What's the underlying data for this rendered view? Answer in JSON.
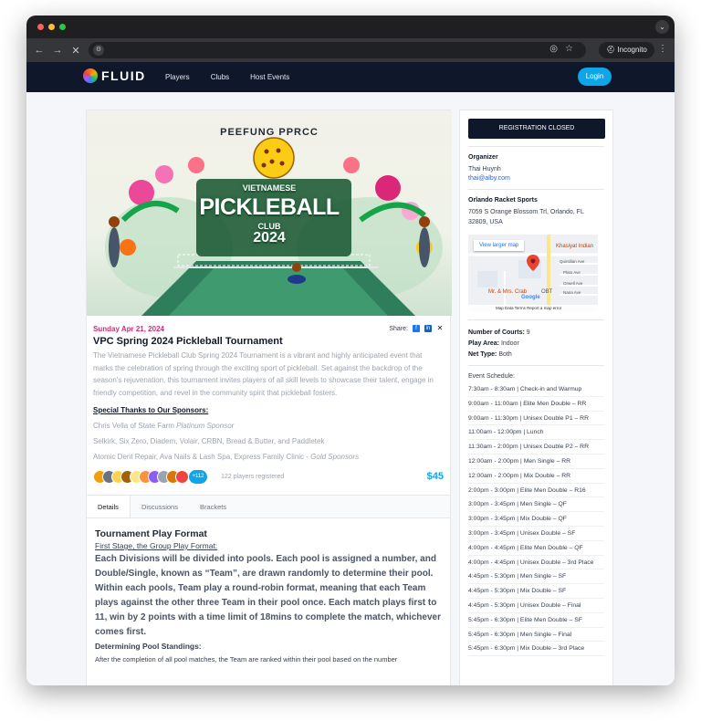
{
  "browser": {
    "back_icon": "←",
    "forward_icon": "→",
    "close_icon": "✕",
    "incognito_label": "Incognito"
  },
  "site": {
    "logo_text": "FLUID",
    "nav": [
      "Players",
      "Clubs",
      "Host Events"
    ],
    "login_label": "Login"
  },
  "banner": {
    "arc_text": "PEEFUNG PPRCC",
    "line1": "VIETNAMESE",
    "line2": "PICKLEBALL",
    "line3": "CLUB",
    "line4": "2024"
  },
  "event": {
    "date": "Sunday Apr 21, 2024",
    "share_label": "Share:",
    "title": "VPC Spring 2024 Pickleball Tournament",
    "description": "The Vietnamese Pickleball Club Spring 2024 Tournament is a vibrant and highly anticipated event that marks the celebration of spring through the exciting sport of pickleball. Set against the backdrop of the season's rejuvenation, this tournament invites players of all skill levels to showcase their talent, engage in friendly competition, and revel in the community spirit that pickleball fosters.",
    "sponsors_heading": "Special Thanks to Our Sponsors:",
    "sponsor1_text": "Chris Vella of State Farm ",
    "sponsor1_tier": "Platinum Sponsor",
    "sponsor2_text": "Selkirk, Six Zero, Diadem, Volair, CRBN, Bread & Butter, and Paddletek",
    "sponsor3_text": "Atomic Dent Repair, Ava Nails & Lash Spa, Express Family Clinic - ",
    "sponsor3_tier": "Gold Sponsors",
    "more_count": "+112",
    "registered": "122 players registered",
    "price": "$45"
  },
  "tabs": [
    "Details",
    "Discussions",
    "Brackets"
  ],
  "details": {
    "heading": "Tournament Play Format",
    "stage_heading": "First Stage, the Group Play Format:",
    "paragraph": "Each Divisions will be divided into pools. Each pool is assigned a number, and Double/Single, known as “Team”, are drawn randomly to determine their pool. Within each pools, Team play a round-robin format, meaning that each Team plays against the other three Team in their pool once. Each match plays first to 11, win by 2 points with a time limit of 18mins to complete the match, whichever comes first.",
    "standings_heading": "Determining Pool Standings:",
    "standings_text": "After the completion of all pool matches, the Team are ranked within their pool based on the number"
  },
  "sidebar": {
    "registration_label": "REGISTRATION CLOSED",
    "organizer_label": "Organizer",
    "organizer_name": "Thai Huynh",
    "organizer_email": "thai@alby.com",
    "venue_name": "Orlando Racket Sports",
    "venue_address": "7059 S Orange Blossom Trl, Orlando, FL 32809, USA",
    "map": {
      "view_larger": "View larger map",
      "place1": "Khasiyat Indian",
      "street1": "Quintilian Ave",
      "street2": "Plato Ave",
      "street3": "Orwell Ave",
      "street4": "Nana Ave",
      "place2": "Mr. & Mrs. Crab",
      "place3": "OBT",
      "google": "Google",
      "footer": "Map Data   Terms   Report a map error"
    },
    "courts_label": "Number of Courts:",
    "courts_value": "9",
    "play_area_label": "Play Area:",
    "play_area_value": "Indoor",
    "net_label": "Net Type:",
    "net_value": "Both",
    "schedule_title": "Event Schedule:",
    "schedule": [
      "7:30am - 8:30am | Check-in and Warmup",
      "9:00am - 11:00am | Elite Men Double – RR",
      "9:00am - 11:30pm | Unisex Double P1 – RR",
      "11:00am - 12:00pm | Lunch",
      "11:30am - 2:00pm | Unisex Double P2 – RR",
      "12:00am - 2:00pm | Men Single – RR",
      "12:00am - 2:00pm | Mix Double – RR",
      "2:00pm - 3:00pm | Elite Men Double – R16",
      "3:00pm - 3:45pm | Men Single – QF",
      "3:00pm - 3:45pm | Mix Double – QF",
      "3:00pm - 3:45pm | Unisex Double – SF",
      "4:00pm - 4:45pm | Elite Men Double – QF",
      "4:00pm - 4:45pm | Unisex Double – 3rd Place",
      "4:45pm - 5:30pm | Men Single – SF",
      "4:45pm - 5:30pm | Mix Double – SF",
      "4:45pm - 5:30pm | Unisex Double – Final",
      "5:45pm - 6:30pm | Elite Men Double – SF",
      "5:45pm - 6:30pm | Men Single – Final",
      "5:45pm - 6:30pm | Mix Double – 3rd Place"
    ]
  }
}
